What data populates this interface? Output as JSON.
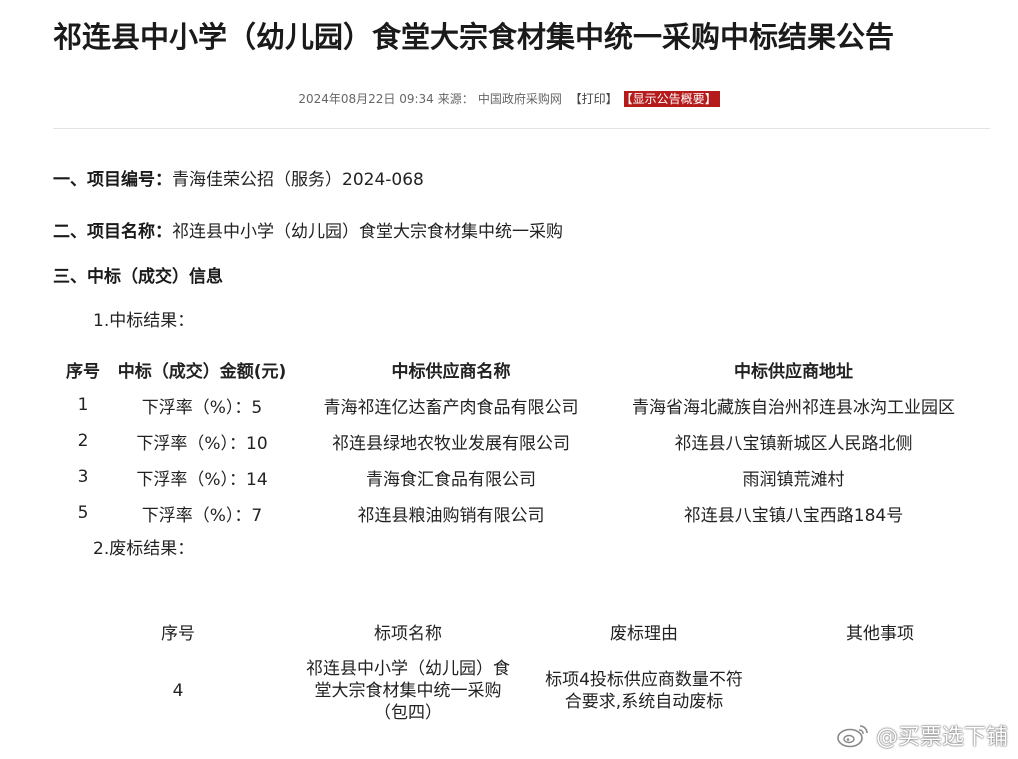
{
  "title": "祁连县中小学（幼儿园）食堂大宗食材集中统一采购中标结果公告",
  "meta": {
    "datetime": "2024年08月22日 09:34",
    "source_label": "来源：",
    "source": "中国政府采购网",
    "print": "【打印】",
    "summary": "【显示公告概要】"
  },
  "sections": {
    "s1_label": "一、项目编号：",
    "s1_value": "青海佳荣公招（服务）2024-068",
    "s2_label": "二、项目名称：",
    "s2_value": "祁连县中小学（幼儿园）食堂大宗食材集中统一采购",
    "s3_label": "三、中标（成交）信息",
    "sub1": "1.中标结果：",
    "sub2": "2.废标结果："
  },
  "winners": {
    "headers": [
      "序号",
      "中标（成交）金额(元)",
      "中标供应商名称",
      "中标供应商地址"
    ],
    "rows": [
      [
        "1",
        "下浮率（%）：5",
        "青海祁连亿达畜产肉食品有限公司",
        "青海省海北藏族自治州祁连县冰沟工业园区"
      ],
      [
        "2",
        "下浮率（%）：10",
        "祁连县绿地农牧业发展有限公司",
        "祁连县八宝镇新城区人民路北侧"
      ],
      [
        "3",
        "下浮率（%）：14",
        "青海食汇食品有限公司",
        "雨润镇荒滩村"
      ],
      [
        "5",
        "下浮率（%）：7",
        "祁连县粮油购销有限公司",
        "祁连县八宝镇八宝西路184号"
      ]
    ]
  },
  "failed": {
    "headers": [
      "序号",
      "标项名称",
      "废标理由",
      "其他事项"
    ],
    "rows": [
      [
        "4",
        "祁连县中小学（幼儿园）食堂大宗食材集中统一采购（包四）",
        "标项4投标供应商数量不符合要求,系统自动废标",
        ""
      ]
    ]
  },
  "watermark": "@买票选下铺"
}
